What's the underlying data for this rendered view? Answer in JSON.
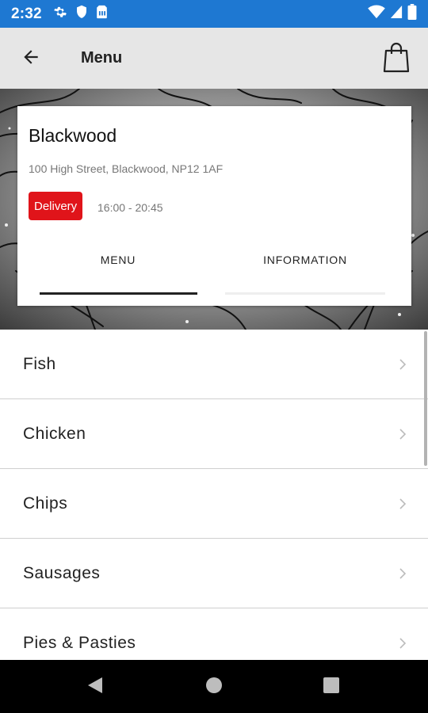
{
  "status_bar": {
    "time": "2:32",
    "left_icons": [
      "gear-icon",
      "shield-icon",
      "sim-card-icon"
    ],
    "right_icons": [
      "wifi-icon",
      "signal-icon",
      "battery-icon"
    ]
  },
  "app_bar": {
    "title": "Menu",
    "back_icon": "arrow-left-icon",
    "cart_icon": "shopping-bag-icon"
  },
  "store": {
    "name": "Blackwood",
    "address": "100 High Street, Blackwood, NP12 1AF",
    "badge": "Delivery",
    "hours": "16:00 - 20:45"
  },
  "tabs": [
    {
      "label": "MENU",
      "active": true
    },
    {
      "label": "INFORMATION",
      "active": false
    }
  ],
  "menu_items": [
    {
      "label": "Fish"
    },
    {
      "label": "Chicken"
    },
    {
      "label": "Chips"
    },
    {
      "label": "Sausages"
    },
    {
      "label": "Pies & Pasties"
    }
  ],
  "colors": {
    "status_bar": "#1e78d2",
    "app_bar": "#e6e6e6",
    "badge": "#e0141a",
    "nav_bar": "#000000"
  }
}
